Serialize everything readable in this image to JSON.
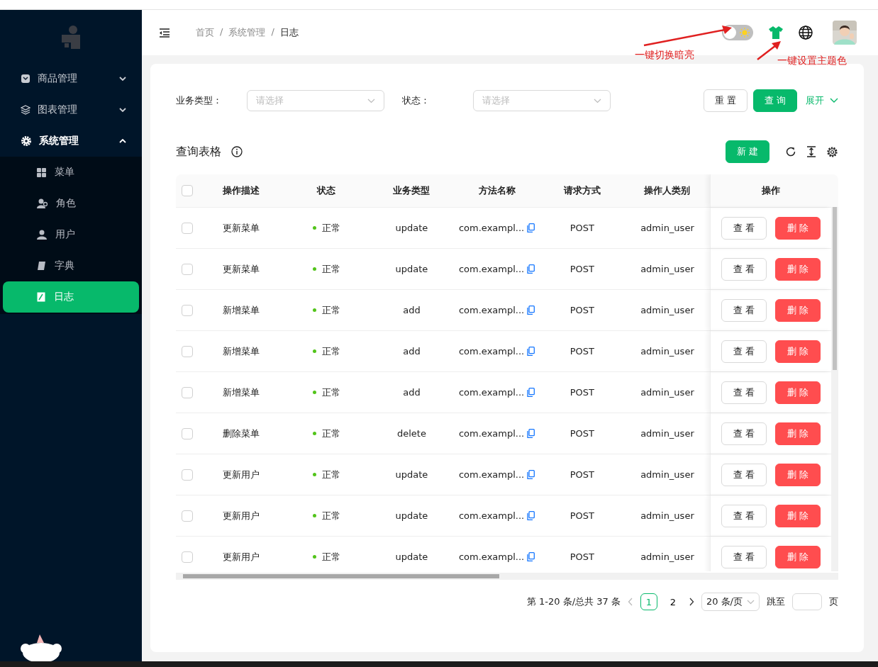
{
  "sidebar": {
    "items": [
      {
        "label": "商品管理",
        "expanded": false
      },
      {
        "label": "图表管理",
        "expanded": false
      },
      {
        "label": "系统管理",
        "expanded": true,
        "children": [
          {
            "label": "菜单",
            "selected": false
          },
          {
            "label": "角色",
            "selected": false
          },
          {
            "label": "用户",
            "selected": false
          },
          {
            "label": "字典",
            "selected": false
          },
          {
            "label": "日志",
            "selected": true
          }
        ]
      }
    ]
  },
  "header": {
    "breadcrumb": [
      {
        "label": "首页"
      },
      {
        "separator": "/",
        "label": "系统管理"
      },
      {
        "separator": "/",
        "label": "日志"
      }
    ],
    "theme_toggle": {
      "on": false
    },
    "annotations": [
      "一键切换暗亮",
      "一键设置主题色"
    ]
  },
  "filters": [
    {
      "label": "业务类型：",
      "placeholder": "请选择"
    },
    {
      "label": "状态：",
      "placeholder": "请选择"
    }
  ],
  "filter_buttons": {
    "reset": "重 置",
    "search": "查 询",
    "expand": "展开"
  },
  "table": {
    "title": "查询表格",
    "new_button": "新 建",
    "select_all": {
      "checked": false
    },
    "columns": [
      "操作描述",
      "状态",
      "业务类型",
      "方法名称",
      "请求方式",
      "操作人类别",
      "操作"
    ],
    "rows": [
      {
        "checked": false,
        "cells": [
          "更新菜单",
          "正常",
          "update",
          "com.exampl...",
          "POST",
          "admin_user"
        ],
        "actions": [
          "查 看",
          "删 除"
        ]
      },
      {
        "checked": false,
        "cells": [
          "更新菜单",
          "正常",
          "update",
          "com.exampl...",
          "POST",
          "admin_user"
        ],
        "actions": [
          "查 看",
          "删 除"
        ]
      },
      {
        "checked": false,
        "cells": [
          "新增菜单",
          "正常",
          "add",
          "com.exampl...",
          "POST",
          "admin_user"
        ],
        "actions": [
          "查 看",
          "删 除"
        ]
      },
      {
        "checked": false,
        "cells": [
          "新增菜单",
          "正常",
          "add",
          "com.exampl...",
          "POST",
          "admin_user"
        ],
        "actions": [
          "查 看",
          "删 除"
        ]
      },
      {
        "checked": false,
        "cells": [
          "新增菜单",
          "正常",
          "add",
          "com.exampl...",
          "POST",
          "admin_user"
        ],
        "actions": [
          "查 看",
          "删 除"
        ]
      },
      {
        "checked": false,
        "cells": [
          "删除菜单",
          "正常",
          "delete",
          "com.exampl...",
          "POST",
          "admin_user"
        ],
        "actions": [
          "查 看",
          "删 除"
        ]
      },
      {
        "checked": false,
        "cells": [
          "更新用户",
          "正常",
          "update",
          "com.exampl...",
          "POST",
          "admin_user"
        ],
        "actions": [
          "查 看",
          "删 除"
        ]
      },
      {
        "checked": false,
        "cells": [
          "更新用户",
          "正常",
          "update",
          "com.exampl...",
          "POST",
          "admin_user"
        ],
        "actions": [
          "查 看",
          "删 除"
        ]
      },
      {
        "checked": false,
        "cells": [
          "更新用户",
          "正常",
          "update",
          "com.exampl...",
          "POST",
          "admin_user"
        ],
        "actions": [
          "查 看",
          "删 除"
        ]
      }
    ]
  },
  "pagination": {
    "summary": "第 1-20 条/总共 37 条",
    "pages": [
      {
        "label": "1",
        "selected": true
      },
      {
        "label": "2",
        "selected": false
      }
    ],
    "page_size": "20 条/页",
    "jump_label": "跳至",
    "page_unit": "页"
  }
}
